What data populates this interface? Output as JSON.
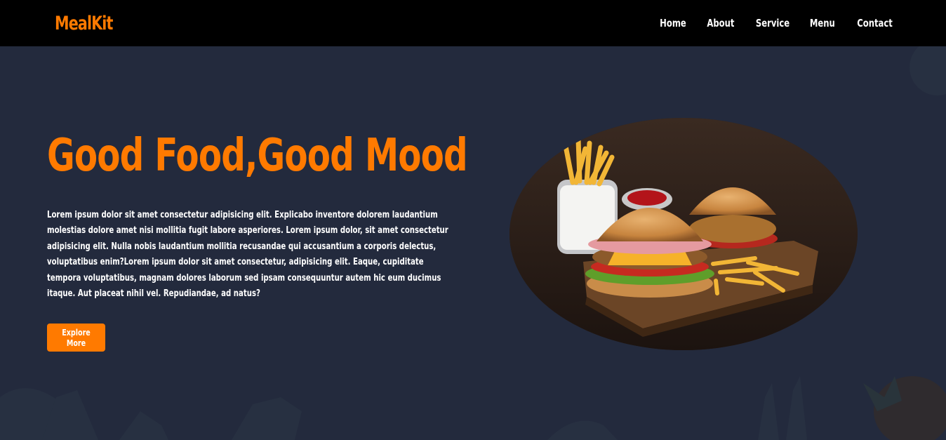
{
  "navbar": {
    "logo": "MealKit",
    "links": [
      {
        "label": "Home"
      },
      {
        "label": "About"
      },
      {
        "label": "Service"
      },
      {
        "label": "Menu"
      },
      {
        "label": "Contact"
      }
    ]
  },
  "hero": {
    "title": "Good Food,Good Mood",
    "description": "Lorem ipsum dolor sit amet consectetur adipisicing elit. Explicabo inventore dolorem laudantium molestias dolore amet nisi mollitia fugit labore asperiores. Lorem ipsum dolor, sit amet consectetur adipisicing elit. Nulla nobis laudantium mollitia recusandae qui accusantium a corporis delectus, voluptatibus enim?Lorem ipsum dolor sit amet consectetur, adipisicing elit. Eaque, cupiditate tempora voluptatibus, magnam dolores laborum sed ipsam consequuntur autem hic eum ducimus itaque. Aut placeat nihil vel. Repudiandae, ad natus?",
    "button_label": "Explore More",
    "image_subject": "burgers-and-fries"
  },
  "colors": {
    "accent": "#ff7a00",
    "navbar_bg": "#000000",
    "hero_bg": "#232a3d",
    "text": "#ffffff"
  }
}
